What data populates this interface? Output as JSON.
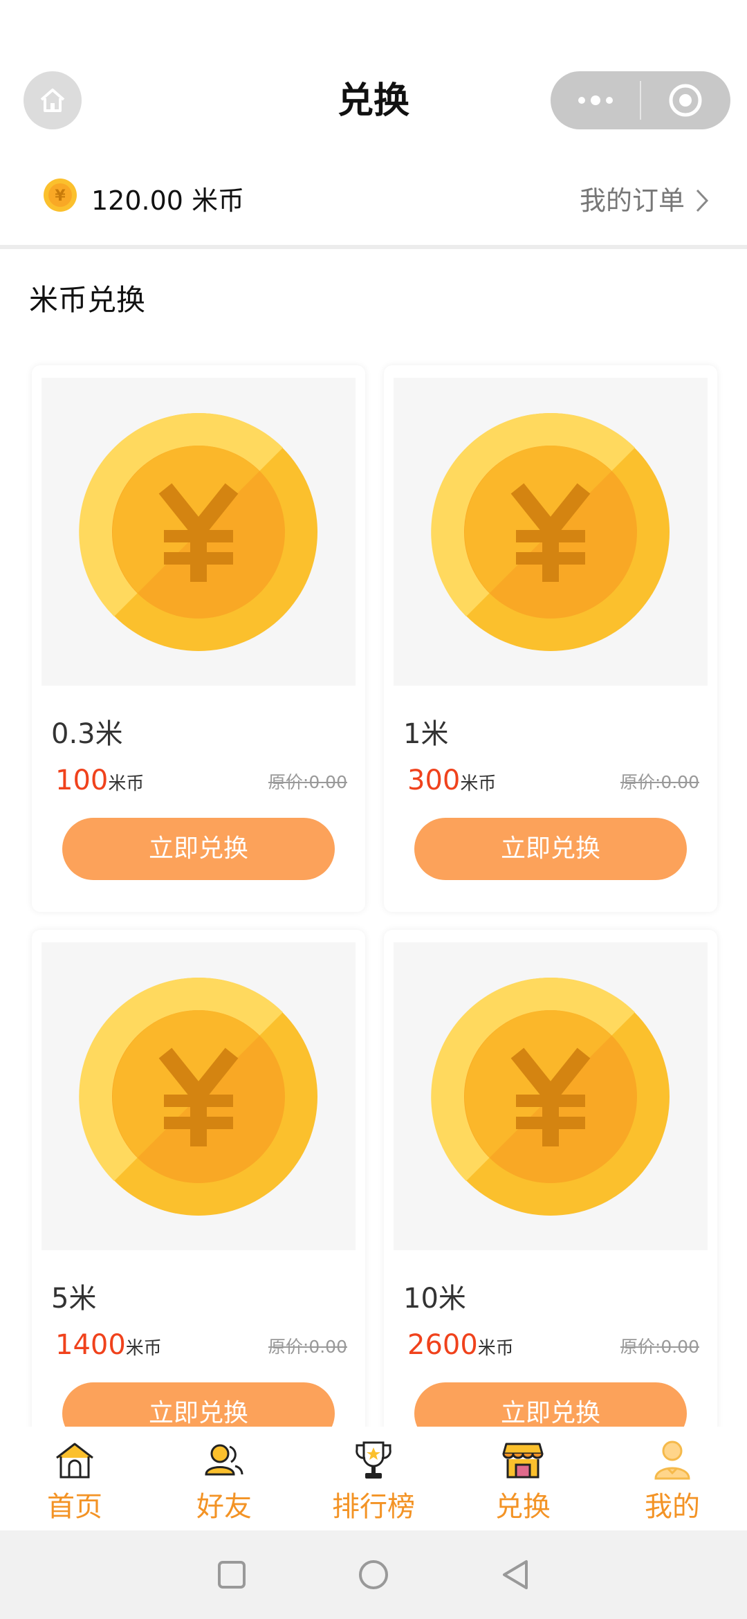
{
  "header": {
    "title": "兑换",
    "home_icon": "home-icon",
    "more_icon": "more-dots-icon",
    "close_icon": "target-circle-icon"
  },
  "balance": {
    "amount": "120.00",
    "unit": "米币",
    "orders_label": "我的订单"
  },
  "section_title": "米币兑换",
  "products": [
    {
      "name": "0.3米",
      "price": "100",
      "unit": "米币",
      "original": "原价:0.00",
      "button": "立即兑换"
    },
    {
      "name": "1米",
      "price": "300",
      "unit": "米币",
      "original": "原价:0.00",
      "button": "立即兑换"
    },
    {
      "name": "5米",
      "price": "1400",
      "unit": "米币",
      "original": "原价:0.00",
      "button": "立即兑换"
    },
    {
      "name": "10米",
      "price": "2600",
      "unit": "米币",
      "original": "原价:0.00",
      "button": "立即兑换"
    }
  ],
  "tabs": [
    {
      "label": "首页",
      "icon": "home-icon"
    },
    {
      "label": "好友",
      "icon": "friends-icon"
    },
    {
      "label": "排行榜",
      "icon": "trophy-icon"
    },
    {
      "label": "兑换",
      "icon": "shop-icon"
    },
    {
      "label": "我的",
      "icon": "profile-icon"
    }
  ],
  "colors": {
    "accent": "#f39325",
    "button": "#fca25a",
    "price": "#f0421c",
    "coin": "#fbc02d"
  }
}
